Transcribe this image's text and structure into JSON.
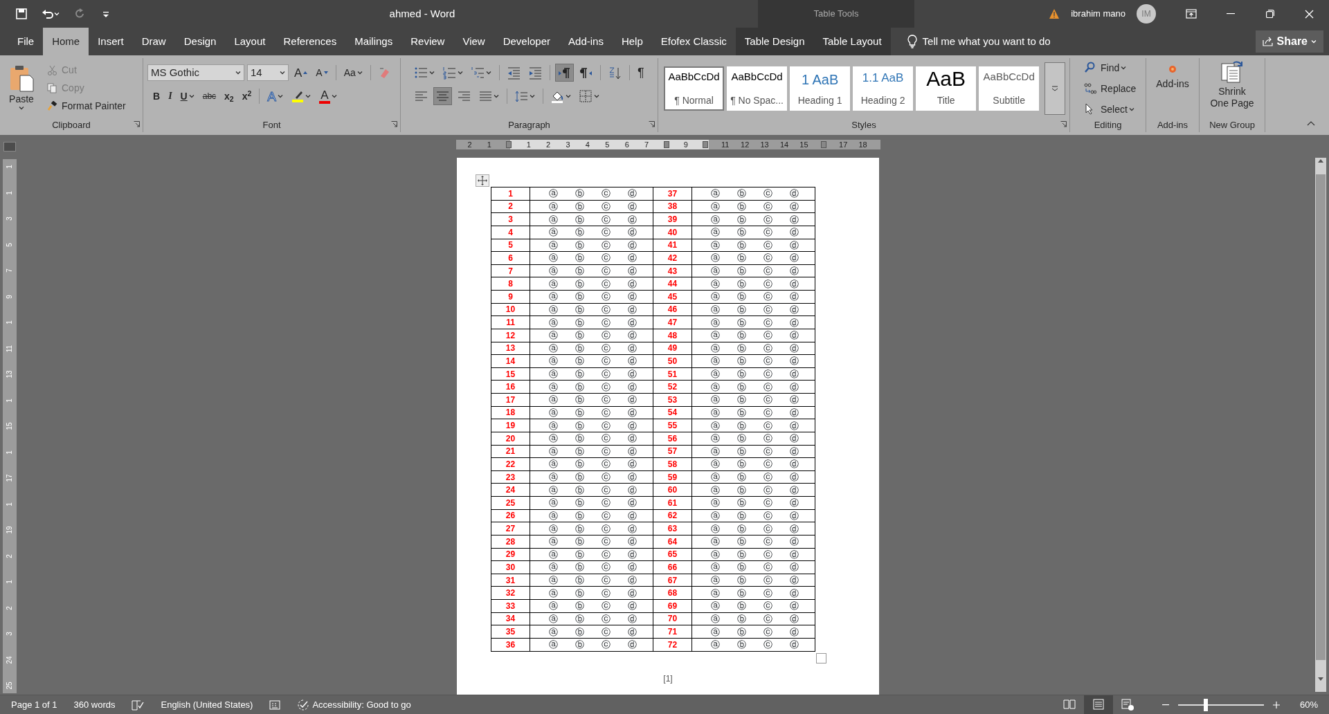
{
  "quick_access": [
    {
      "kind": "save",
      "disabled": false
    },
    {
      "kind": "undo",
      "disabled": false
    },
    {
      "kind": "redo",
      "disabled": true
    },
    {
      "kind": "customize",
      "disabled": false
    }
  ],
  "title": "ahmed  -  Word",
  "contextual_label": "Table Tools",
  "user": {
    "name": "ibrahim mano",
    "initials": "IM"
  },
  "tabs": [
    {
      "label": "File",
      "selected": false,
      "contextual": false
    },
    {
      "label": "Home",
      "selected": true,
      "contextual": false
    },
    {
      "label": "Insert",
      "selected": false,
      "contextual": false
    },
    {
      "label": "Draw",
      "selected": false,
      "contextual": false
    },
    {
      "label": "Design",
      "selected": false,
      "contextual": false
    },
    {
      "label": "Layout",
      "selected": false,
      "contextual": false
    },
    {
      "label": "References",
      "selected": false,
      "contextual": false
    },
    {
      "label": "Mailings",
      "selected": false,
      "contextual": false
    },
    {
      "label": "Review",
      "selected": false,
      "contextual": false
    },
    {
      "label": "View",
      "selected": false,
      "contextual": false
    },
    {
      "label": "Developer",
      "selected": false,
      "contextual": false
    },
    {
      "label": "Add-ins",
      "selected": false,
      "contextual": false
    },
    {
      "label": "Help",
      "selected": false,
      "contextual": false
    },
    {
      "label": "Efofex Classic",
      "selected": false,
      "contextual": false
    },
    {
      "label": "Table Design",
      "selected": false,
      "contextual": true
    },
    {
      "label": "Table Layout",
      "selected": false,
      "contextual": true
    }
  ],
  "tell_me": {
    "placeholder": "Tell me what you want to do"
  },
  "share": "Share",
  "clipboard": {
    "label": "Clipboard",
    "paste": "Paste",
    "items": [
      {
        "kind": "cut",
        "label": "Cut",
        "disabled": true
      },
      {
        "kind": "copy",
        "label": "Copy",
        "disabled": true
      },
      {
        "kind": "painter",
        "label": "Format Painter",
        "disabled": false
      }
    ]
  },
  "font": {
    "label": "Font",
    "name": "MS Gothic",
    "size": "14",
    "row1": [
      {
        "kind": "grow",
        "label": "A"
      },
      {
        "kind": "shrink",
        "label": "A"
      },
      {
        "kind": "case",
        "label": "Aa"
      },
      {
        "kind": "clear"
      }
    ],
    "row2": [
      {
        "kind": "bold",
        "label": "B"
      },
      {
        "kind": "italic",
        "label": "I"
      },
      {
        "kind": "underline",
        "label": "U"
      },
      {
        "kind": "strike",
        "label": "abc"
      },
      {
        "kind": "sub",
        "label": "x$_{2}$"
      },
      {
        "kind": "sup",
        "label": "x$^{2}$"
      },
      {
        "kind": "effects",
        "label": "A"
      },
      {
        "kind": "highlight"
      },
      {
        "kind": "color",
        "label": "A"
      }
    ]
  },
  "paragraph": {
    "label": "Paragraph",
    "row1": [
      {
        "kind": "bullets",
        "pressed": false
      },
      {
        "kind": "numbering",
        "pressed": false
      },
      {
        "kind": "multilevel",
        "pressed": false
      },
      {
        "kind": "outdent",
        "pressed": false
      },
      {
        "kind": "indent",
        "pressed": false
      },
      {
        "kind": "ltr",
        "pressed": true
      },
      {
        "kind": "rtl",
        "pressed": false
      },
      {
        "kind": "sort",
        "pressed": false
      },
      {
        "kind": "marks",
        "label": "¶",
        "pressed": false
      }
    ],
    "row2": [
      {
        "kind": "align_left",
        "pressed": false
      },
      {
        "kind": "align_center",
        "pressed": true
      },
      {
        "kind": "align_right",
        "pressed": false
      },
      {
        "kind": "justify",
        "pressed": false
      },
      {
        "kind": "line_spacing",
        "pressed": false
      },
      {
        "kind": "shading",
        "pressed": false
      },
      {
        "kind": "borders",
        "pressed": false
      }
    ]
  },
  "styles": {
    "label": "Styles",
    "items": [
      {
        "kind": "normal",
        "sample": "AaBbCcDd",
        "name": "¶ Normal",
        "selected": true
      },
      {
        "kind": "normal",
        "sample": "AaBbCcDd",
        "name": "¶ No Spac...",
        "selected": false
      },
      {
        "kind": "heading",
        "sample": "1  AaB",
        "name": "Heading 1",
        "selected": false
      },
      {
        "kind": "heading2",
        "sample": "1.1  AaB",
        "name": "Heading 2",
        "selected": false
      },
      {
        "kind": "title",
        "sample": "AaB",
        "name": "Title",
        "selected": false
      },
      {
        "kind": "subtitle",
        "sample": "AaBbCcDd",
        "name": "Subtitle",
        "selected": false
      }
    ]
  },
  "editing": {
    "label": "Editing",
    "items": [
      {
        "kind": "find",
        "label": "Find"
      },
      {
        "kind": "replace",
        "label": "Replace"
      },
      {
        "kind": "select",
        "label": "Select"
      }
    ]
  },
  "addins": {
    "label": "Add-ins",
    "button": "Add-ins"
  },
  "new_group": {
    "label": "New Group",
    "button": "Shrink One Page"
  },
  "ruler": {
    "labels": [
      "2",
      "1",
      "1",
      "2",
      "3",
      "4",
      "5",
      "6",
      "7",
      "9",
      "11",
      "12",
      "13",
      "14",
      "15",
      "17",
      "18"
    ]
  },
  "vertical_ruler": {
    "labels": [
      "1",
      "1",
      "3",
      "5",
      "7",
      "9",
      "1",
      "11",
      "13",
      "1",
      "15",
      "1",
      "17",
      "1",
      "19",
      "2",
      "1",
      "2",
      "3",
      "24",
      "25"
    ]
  },
  "table": {
    "rows": [
      {
        "number_a": "1",
        "choices_a": [
          "ⓐ",
          "ⓑ",
          "ⓒ",
          "ⓓ"
        ],
        "number_b": "37",
        "choices_b": [
          "ⓐ",
          "ⓑ",
          "ⓒ",
          "ⓓ"
        ]
      },
      {
        "number_a": "2",
        "choices_a": [
          "ⓐ",
          "ⓑ",
          "ⓒ",
          "ⓓ"
        ],
        "number_b": "38",
        "choices_b": [
          "ⓐ",
          "ⓑ",
          "ⓒ",
          "ⓓ"
        ]
      },
      {
        "number_a": "3",
        "choices_a": [
          "ⓐ",
          "ⓑ",
          "ⓒ",
          "ⓓ"
        ],
        "number_b": "39",
        "choices_b": [
          "ⓐ",
          "ⓑ",
          "ⓒ",
          "ⓓ"
        ]
      },
      {
        "number_a": "4",
        "choices_a": [
          "ⓐ",
          "ⓑ",
          "ⓒ",
          "ⓓ"
        ],
        "number_b": "40",
        "choices_b": [
          "ⓐ",
          "ⓑ",
          "ⓒ",
          "ⓓ"
        ]
      },
      {
        "number_a": "5",
        "choices_a": [
          "ⓐ",
          "ⓑ",
          "ⓒ",
          "ⓓ"
        ],
        "number_b": "41",
        "choices_b": [
          "ⓐ",
          "ⓑ",
          "ⓒ",
          "ⓓ"
        ]
      },
      {
        "number_a": "6",
        "choices_a": [
          "ⓐ",
          "ⓑ",
          "ⓒ",
          "ⓓ"
        ],
        "number_b": "42",
        "choices_b": [
          "ⓐ",
          "ⓑ",
          "ⓒ",
          "ⓓ"
        ]
      },
      {
        "number_a": "7",
        "choices_a": [
          "ⓐ",
          "ⓑ",
          "ⓒ",
          "ⓓ"
        ],
        "number_b": "43",
        "choices_b": [
          "ⓐ",
          "ⓑ",
          "ⓒ",
          "ⓓ"
        ]
      },
      {
        "number_a": "8",
        "choices_a": [
          "ⓐ",
          "ⓑ",
          "ⓒ",
          "ⓓ"
        ],
        "number_b": "44",
        "choices_b": [
          "ⓐ",
          "ⓑ",
          "ⓒ",
          "ⓓ"
        ]
      },
      {
        "number_a": "9",
        "choices_a": [
          "ⓐ",
          "ⓑ",
          "ⓒ",
          "ⓓ"
        ],
        "number_b": "45",
        "choices_b": [
          "ⓐ",
          "ⓑ",
          "ⓒ",
          "ⓓ"
        ]
      },
      {
        "number_a": "10",
        "choices_a": [
          "ⓐ",
          "ⓑ",
          "ⓒ",
          "ⓓ"
        ],
        "number_b": "46",
        "choices_b": [
          "ⓐ",
          "ⓑ",
          "ⓒ",
          "ⓓ"
        ]
      },
      {
        "number_a": "11",
        "choices_a": [
          "ⓐ",
          "ⓑ",
          "ⓒ",
          "ⓓ"
        ],
        "number_b": "47",
        "choices_b": [
          "ⓐ",
          "ⓑ",
          "ⓒ",
          "ⓓ"
        ]
      },
      {
        "number_a": "12",
        "choices_a": [
          "ⓐ",
          "ⓑ",
          "ⓒ",
          "ⓓ"
        ],
        "number_b": "48",
        "choices_b": [
          "ⓐ",
          "ⓑ",
          "ⓒ",
          "ⓓ"
        ]
      },
      {
        "number_a": "13",
        "choices_a": [
          "ⓐ",
          "ⓑ",
          "ⓒ",
          "ⓓ"
        ],
        "number_b": "49",
        "choices_b": [
          "ⓐ",
          "ⓑ",
          "ⓒ",
          "ⓓ"
        ]
      },
      {
        "number_a": "14",
        "choices_a": [
          "ⓐ",
          "ⓑ",
          "ⓒ",
          "ⓓ"
        ],
        "number_b": "50",
        "choices_b": [
          "ⓐ",
          "ⓑ",
          "ⓒ",
          "ⓓ"
        ]
      },
      {
        "number_a": "15",
        "choices_a": [
          "ⓐ",
          "ⓑ",
          "ⓒ",
          "ⓓ"
        ],
        "number_b": "51",
        "choices_b": [
          "ⓐ",
          "ⓑ",
          "ⓒ",
          "ⓓ"
        ]
      },
      {
        "number_a": "16",
        "choices_a": [
          "ⓐ",
          "ⓑ",
          "ⓒ",
          "ⓓ"
        ],
        "number_b": "52",
        "choices_b": [
          "ⓐ",
          "ⓑ",
          "ⓒ",
          "ⓓ"
        ]
      },
      {
        "number_a": "17",
        "choices_a": [
          "ⓐ",
          "ⓑ",
          "ⓒ",
          "ⓓ"
        ],
        "number_b": "53",
        "choices_b": [
          "ⓐ",
          "ⓑ",
          "ⓒ",
          "ⓓ"
        ]
      },
      {
        "number_a": "18",
        "choices_a": [
          "ⓐ",
          "ⓑ",
          "ⓒ",
          "ⓓ"
        ],
        "number_b": "54",
        "choices_b": [
          "ⓐ",
          "ⓑ",
          "ⓒ",
          "ⓓ"
        ]
      },
      {
        "number_a": "19",
        "choices_a": [
          "ⓐ",
          "ⓑ",
          "ⓒ",
          "ⓓ"
        ],
        "number_b": "55",
        "choices_b": [
          "ⓐ",
          "ⓑ",
          "ⓒ",
          "ⓓ"
        ]
      },
      {
        "number_a": "20",
        "choices_a": [
          "ⓐ",
          "ⓑ",
          "ⓒ",
          "ⓓ"
        ],
        "number_b": "56",
        "choices_b": [
          "ⓐ",
          "ⓑ",
          "ⓒ",
          "ⓓ"
        ]
      },
      {
        "number_a": "21",
        "choices_a": [
          "ⓐ",
          "ⓑ",
          "ⓒ",
          "ⓓ"
        ],
        "number_b": "57",
        "choices_b": [
          "ⓐ",
          "ⓑ",
          "ⓒ",
          "ⓓ"
        ]
      },
      {
        "number_a": "22",
        "choices_a": [
          "ⓐ",
          "ⓑ",
          "ⓒ",
          "ⓓ"
        ],
        "number_b": "58",
        "choices_b": [
          "ⓐ",
          "ⓑ",
          "ⓒ",
          "ⓓ"
        ]
      },
      {
        "number_a": "23",
        "choices_a": [
          "ⓐ",
          "ⓑ",
          "ⓒ",
          "ⓓ"
        ],
        "number_b": "59",
        "choices_b": [
          "ⓐ",
          "ⓑ",
          "ⓒ",
          "ⓓ"
        ]
      },
      {
        "number_a": "24",
        "choices_a": [
          "ⓐ",
          "ⓑ",
          "ⓒ",
          "ⓓ"
        ],
        "number_b": "60",
        "choices_b": [
          "ⓐ",
          "ⓑ",
          "ⓒ",
          "ⓓ"
        ]
      },
      {
        "number_a": "25",
        "choices_a": [
          "ⓐ",
          "ⓑ",
          "ⓒ",
          "ⓓ"
        ],
        "number_b": "61",
        "choices_b": [
          "ⓐ",
          "ⓑ",
          "ⓒ",
          "ⓓ"
        ]
      },
      {
        "number_a": "26",
        "choices_a": [
          "ⓐ",
          "ⓑ",
          "ⓒ",
          "ⓓ"
        ],
        "number_b": "62",
        "choices_b": [
          "ⓐ",
          "ⓑ",
          "ⓒ",
          "ⓓ"
        ]
      },
      {
        "number_a": "27",
        "choices_a": [
          "ⓐ",
          "ⓑ",
          "ⓒ",
          "ⓓ"
        ],
        "number_b": "63",
        "choices_b": [
          "ⓐ",
          "ⓑ",
          "ⓒ",
          "ⓓ"
        ]
      },
      {
        "number_a": "28",
        "choices_a": [
          "ⓐ",
          "ⓑ",
          "ⓒ",
          "ⓓ"
        ],
        "number_b": "64",
        "choices_b": [
          "ⓐ",
          "ⓑ",
          "ⓒ",
          "ⓓ"
        ]
      },
      {
        "number_a": "29",
        "choices_a": [
          "ⓐ",
          "ⓑ",
          "ⓒ",
          "ⓓ"
        ],
        "number_b": "65",
        "choices_b": [
          "ⓐ",
          "ⓑ",
          "ⓒ",
          "ⓓ"
        ]
      },
      {
        "number_a": "30",
        "choices_a": [
          "ⓐ",
          "ⓑ",
          "ⓒ",
          "ⓓ"
        ],
        "number_b": "66",
        "choices_b": [
          "ⓐ",
          "ⓑ",
          "ⓒ",
          "ⓓ"
        ]
      },
      {
        "number_a": "31",
        "choices_a": [
          "ⓐ",
          "ⓑ",
          "ⓒ",
          "ⓓ"
        ],
        "number_b": "67",
        "choices_b": [
          "ⓐ",
          "ⓑ",
          "ⓒ",
          "ⓓ"
        ]
      },
      {
        "number_a": "32",
        "choices_a": [
          "ⓐ",
          "ⓑ",
          "ⓒ",
          "ⓓ"
        ],
        "number_b": "68",
        "choices_b": [
          "ⓐ",
          "ⓑ",
          "ⓒ",
          "ⓓ"
        ]
      },
      {
        "number_a": "33",
        "choices_a": [
          "ⓐ",
          "ⓑ",
          "ⓒ",
          "ⓓ"
        ],
        "number_b": "69",
        "choices_b": [
          "ⓐ",
          "ⓑ",
          "ⓒ",
          "ⓓ"
        ]
      },
      {
        "number_a": "34",
        "choices_a": [
          "ⓐ",
          "ⓑ",
          "ⓒ",
          "ⓓ"
        ],
        "number_b": "70",
        "choices_b": [
          "ⓐ",
          "ⓑ",
          "ⓒ",
          "ⓓ"
        ]
      },
      {
        "number_a": "35",
        "choices_a": [
          "ⓐ",
          "ⓑ",
          "ⓒ",
          "ⓓ"
        ],
        "number_b": "71",
        "choices_b": [
          "ⓐ",
          "ⓑ",
          "ⓒ",
          "ⓓ"
        ]
      },
      {
        "number_a": "36",
        "choices_a": [
          "ⓐ",
          "ⓑ",
          "ⓒ",
          "ⓓ"
        ],
        "number_b": "72",
        "choices_b": [
          "ⓐ",
          "ⓑ",
          "ⓒ",
          "ⓓ"
        ]
      }
    ]
  },
  "page_footer": "[1]",
  "status_bar": {
    "items": [
      {
        "kind": "text",
        "label": "Page 1 of 1"
      },
      {
        "kind": "text",
        "label": "360 words"
      },
      {
        "kind": "proofing"
      },
      {
        "kind": "text",
        "label": "English (United States)"
      },
      {
        "kind": "macro"
      },
      {
        "kind": "accessibility",
        "label": "Accessibility: Good to go"
      }
    ],
    "views": [
      {
        "kind": "read",
        "selected": false
      },
      {
        "kind": "print",
        "selected": true
      },
      {
        "kind": "web",
        "selected": false
      }
    ],
    "zoom": {
      "level": 0.3,
      "reading": "60%"
    }
  }
}
